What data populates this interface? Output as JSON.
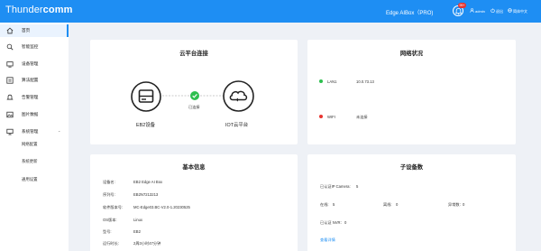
{
  "header": {
    "logo_regular": "Thunder",
    "logo_bold": "comm",
    "product": "Edge AIBox（PRO)",
    "notify_badge": "99+",
    "user": "admin",
    "exit": "退出",
    "language": "简体中文"
  },
  "sidebar": {
    "items": [
      {
        "label": "首页"
      },
      {
        "label": "智能监控"
      },
      {
        "label": "设备管理"
      },
      {
        "label": "算法配置"
      },
      {
        "label": "告警管理"
      },
      {
        "label": "图片数据"
      },
      {
        "label": "系统管理"
      }
    ],
    "sub_items": [
      {
        "label": "网络配置"
      },
      {
        "label": "系统更新"
      },
      {
        "label": "通用设置"
      }
    ]
  },
  "cloud": {
    "title": "云平台连接",
    "device_label": "EB2设备",
    "status": "已连接",
    "cloud_label": "IOT云平台"
  },
  "network": {
    "title": "网络状况",
    "rows": [
      {
        "name": "LAN1",
        "value": "10.0.73.13",
        "color": "#2dbf4e"
      },
      {
        "name": "WIFI",
        "value": "未连接",
        "color": "#e8342f"
      }
    ]
  },
  "basic": {
    "title": "基本信息",
    "rows": [
      {
        "label": "设备名:",
        "value": "EB2 Edge AI Box"
      },
      {
        "label": "序列号:",
        "value": "EB2N7213213"
      },
      {
        "label": "软件版本号:",
        "value": "MC-Edge03.BC-V2.0-1.20230525"
      },
      {
        "label": "OS版本:",
        "value": "Linux"
      },
      {
        "label": "型号:",
        "value": "EB2"
      },
      {
        "label": "运行时长:",
        "value": "2周3小时47分钟"
      }
    ]
  },
  "subdev": {
    "title": "子设备数",
    "camera_label": "已认证IP Camera:",
    "camera_value": "5",
    "online_label": "在线:",
    "online_value": "5",
    "offline_label": "离线:",
    "offline_value": "0",
    "abnormal_label": "异常数:",
    "abnormal_value": "0",
    "nvr_label": "已认证 NVR:",
    "nvr_value": "0",
    "link": "查看详情"
  },
  "colors": {
    "accent": "#1e8ef3",
    "online": "#2dbf4e",
    "offline": "#e8342f"
  }
}
